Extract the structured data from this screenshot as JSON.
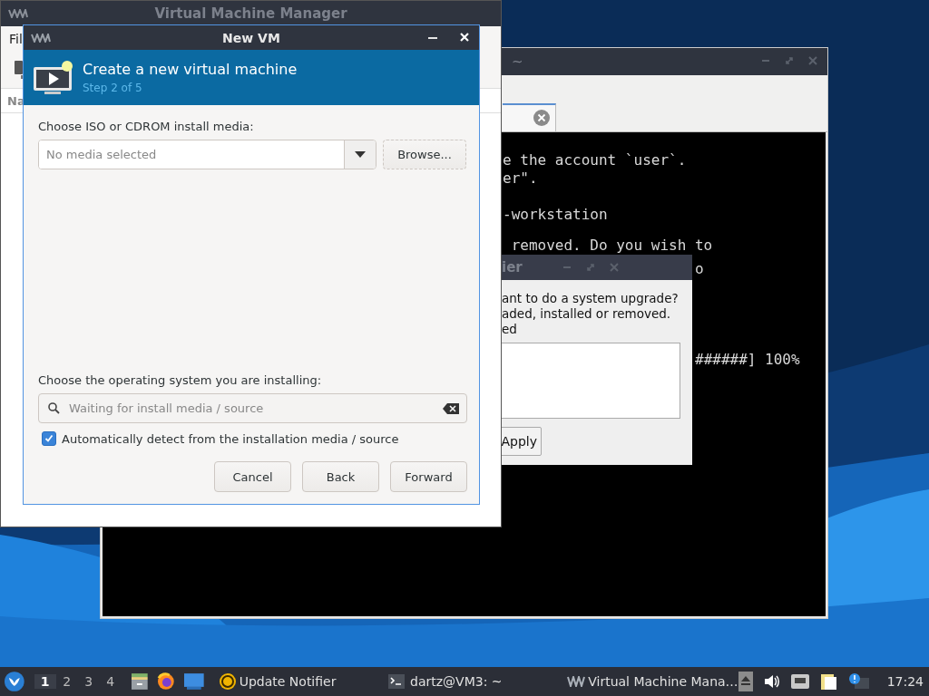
{
  "vmm_window": {
    "title": "Virtual Machine Manager",
    "menu_text": "Fil",
    "column_text": "Na"
  },
  "terminal_window": {
    "title": "~",
    "lines": [
      {
        "text": "e the account `user`."
      },
      {
        "text": "er\"."
      },
      {
        "text": "-workstation"
      },
      {
        "text": " removed. Do you wish to"
      },
      {
        "text": "o"
      },
      {
        "text": "######] 100%"
      }
    ]
  },
  "notifier_window": {
    "title": "ier",
    "lines": [
      "ant to do a system upgrade?",
      "aded, installed or removed.",
      "ed"
    ],
    "button": "Apply"
  },
  "new_vm_dialog": {
    "title": "New VM",
    "heading": "Create a new virtual machine",
    "step": "Step 2 of 5",
    "media_label": "Choose ISO or CDROM install media:",
    "media_combo": {
      "placeholder": "No media selected"
    },
    "browse_button": "Browse...",
    "os_label": "Choose the operating system you are installing:",
    "os_search": {
      "placeholder": "Waiting for install media / source"
    },
    "auto_detect": {
      "label": "Automatically detect from the installation media / source",
      "checked": true
    },
    "buttons": [
      "Cancel",
      "Back",
      "Forward"
    ]
  },
  "taskbar": {
    "workspaces": [
      {
        "label": "1",
        "selected": true
      },
      {
        "label": "2",
        "selected": false
      },
      {
        "label": "3",
        "selected": false
      },
      {
        "label": "4",
        "selected": false
      }
    ],
    "tasks": [
      {
        "label": "Update Notifier",
        "kind": "notifier"
      },
      {
        "label": "dartz@VM3: ~",
        "kind": "terminal"
      },
      {
        "label": "Virtual Machine Mana…",
        "kind": "vmm"
      }
    ],
    "clock": "17:24"
  }
}
